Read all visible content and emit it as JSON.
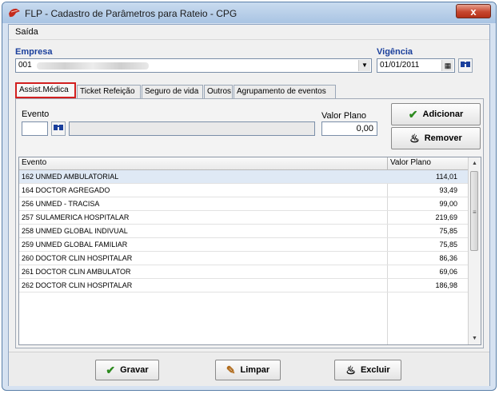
{
  "window": {
    "title": "FLP - Cadastro de Parâmetros para Rateio - CPG",
    "close_label": "x"
  },
  "menu": {
    "items": [
      "Saída"
    ]
  },
  "empresa": {
    "label": "Empresa",
    "value": "001"
  },
  "vigencia": {
    "label": "Vigência",
    "value": "01/01/2011"
  },
  "tabs": [
    "Assist.Médica",
    "Ticket Refeição",
    "Seguro de vida",
    "Outros",
    "Agrupamento de eventos"
  ],
  "evento": {
    "label": "Evento",
    "code": "",
    "description": ""
  },
  "valor_plano": {
    "label": "Valor Plano",
    "value": "0,00"
  },
  "buttons": {
    "adicionar": "Adicionar",
    "remover": "Remover",
    "gravar": "Gravar",
    "limpar": "Limpar",
    "excluir": "Excluir"
  },
  "grid": {
    "columns": [
      "Evento",
      "Valor Plano"
    ],
    "rows": [
      {
        "evento": "162 UNMED AMBULATORIAL",
        "valor": "114,01"
      },
      {
        "evento": "164 DOCTOR AGREGADO",
        "valor": "93,49"
      },
      {
        "evento": "256 UNMED - TRACISA",
        "valor": "99,00"
      },
      {
        "evento": "257 SULAMERICA HOSPITALAR",
        "valor": "219,69"
      },
      {
        "evento": "258 UNMED GLOBAL INDIVUAL",
        "valor": "75,85"
      },
      {
        "evento": "259 UNMED GLOBAL FAMILIAR",
        "valor": "75,85"
      },
      {
        "evento": "260 DOCTOR CLIN HOSPITALAR",
        "valor": "86,36"
      },
      {
        "evento": "261 DOCTOR CLIN AMBULATOR",
        "valor": "69,06"
      },
      {
        "evento": "262 DOCTOR CLIN HOSPITALAR",
        "valor": "186,98"
      }
    ]
  },
  "icons": {
    "window": "app-icon",
    "search": "binoculars-icon",
    "calendar": "calendar-icon",
    "check": "check-icon",
    "remove": "remove-icon",
    "clear": "eraser-icon",
    "delete": "delete-icon"
  }
}
